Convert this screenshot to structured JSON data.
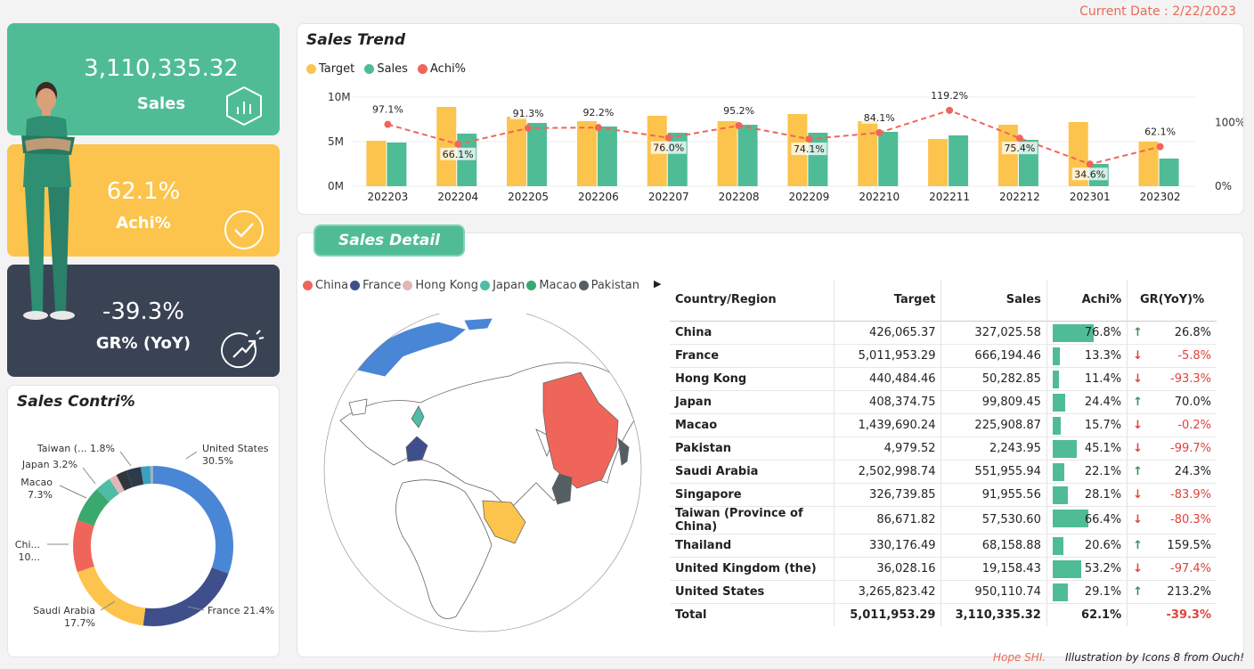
{
  "current_date": "Current Date : 2/22/2023",
  "kpi": {
    "sales_value": "3,110,335.32",
    "sales_label": "Sales",
    "achi_value": "62.1%",
    "achi_label": "Achi%",
    "gr_value": "-39.3%",
    "gr_label": "GR% (YoY)"
  },
  "colors": {
    "target": "#fcc44c",
    "sales": "#4fbc96",
    "achi": "#f0655a",
    "kpi_green": "#4fbc96",
    "kpi_yellow": "#fcc44c",
    "kpi_dark": "#3a4354",
    "down": "#e0413a",
    "up": "#3e8d58"
  },
  "trend": {
    "title": "Sales Trend",
    "legend": [
      "Target",
      "Sales",
      "Achi%"
    ],
    "y_ticks": [
      "10M",
      "5M",
      "0M"
    ],
    "y2_ticks": [
      "100%",
      "0%"
    ]
  },
  "chart_data": [
    {
      "type": "bar",
      "title": "Sales Trend",
      "categories": [
        "202203",
        "202204",
        "202205",
        "202206",
        "202207",
        "202208",
        "202209",
        "202210",
        "202211",
        "202212",
        "202301",
        "202302"
      ],
      "series": [
        {
          "name": "Target",
          "values": [
            5.1,
            8.9,
            7.8,
            7.3,
            7.9,
            7.3,
            8.1,
            7.3,
            5.3,
            6.9,
            7.2,
            5.0
          ]
        },
        {
          "name": "Sales",
          "values": [
            4.9,
            5.9,
            7.1,
            6.7,
            6.0,
            6.9,
            6.0,
            6.1,
            5.7,
            5.2,
            2.5,
            3.1
          ]
        },
        {
          "name": "Achi%",
          "values": [
            97.1,
            66.1,
            91.3,
            92.2,
            76.0,
            95.2,
            74.1,
            84.1,
            119.2,
            75.4,
            34.6,
            62.1
          ]
        }
      ],
      "labels": [
        "97.1%",
        "66.1%",
        "91.3%",
        "92.2%",
        "76.0%",
        "95.2%",
        "74.1%",
        "84.1%",
        "119.2%",
        "75.4%",
        "34.6%",
        "62.1%"
      ],
      "ylim": [
        0,
        10
      ],
      "y2lim": [
        0,
        140
      ]
    },
    {
      "type": "pie",
      "title": "Sales Contri%",
      "categories": [
        "United States",
        "France",
        "Saudi Arabia",
        "China",
        "Macao",
        "Japan",
        "Hong Kong",
        "Thailand",
        "Singapore",
        "Pakistan",
        "Taiwan (Province of China)",
        "United Kingdom (the)"
      ],
      "values": [
        30.5,
        21.4,
        17.7,
        10.5,
        7.3,
        3.2,
        1.6,
        2.2,
        2.9,
        0.1,
        1.8,
        0.6
      ]
    }
  ],
  "contri": {
    "title": "Sales Contri%",
    "labels": [
      {
        "l1": "United States",
        "l2": "30.5%"
      },
      {
        "l1": "France 21.4%",
        "l2": ""
      },
      {
        "l1": "Saudi Arabia",
        "l2": "17.7%"
      },
      {
        "l1": "Chi...",
        "l2": "10..."
      },
      {
        "l1": "Macao",
        "l2": "7.3%"
      },
      {
        "l1": "Japan 3.2%",
        "l2": ""
      },
      {
        "l1": "Taiwan (... 1.8%",
        "l2": ""
      }
    ]
  },
  "detail": {
    "title": "Sales Detail",
    "map_legend": [
      "China",
      "France",
      "Hong Kong",
      "Japan",
      "Macao",
      "Pakistan"
    ],
    "map_legend_colors": [
      "#f0655a",
      "#3f4f8c",
      "#e2b7b7",
      "#4fbca6",
      "#3aa96e",
      "#555e63"
    ],
    "headers": [
      "Country/Region",
      "Target",
      "Sales",
      "Achi%",
      "GR(YoY)%"
    ],
    "rows": [
      {
        "name": "China",
        "target": "426,065.37",
        "sales": "327,025.58",
        "achi": "76.8%",
        "achi_v": 76.8,
        "gr": "26.8%",
        "dir": "up"
      },
      {
        "name": "France",
        "target": "5,011,953.29",
        "sales": "666,194.46",
        "achi": "13.3%",
        "achi_v": 13.3,
        "gr": "-5.8%",
        "dir": "down"
      },
      {
        "name": "Hong Kong",
        "target": "440,484.46",
        "sales": "50,282.85",
        "achi": "11.4%",
        "achi_v": 11.4,
        "gr": "-93.3%",
        "dir": "down"
      },
      {
        "name": "Japan",
        "target": "408,374.75",
        "sales": "99,809.45",
        "achi": "24.4%",
        "achi_v": 24.4,
        "gr": "70.0%",
        "dir": "up"
      },
      {
        "name": "Macao",
        "target": "1,439,690.24",
        "sales": "225,908.87",
        "achi": "15.7%",
        "achi_v": 15.7,
        "gr": "-0.2%",
        "dir": "down"
      },
      {
        "name": "Pakistan",
        "target": "4,979.52",
        "sales": "2,243.95",
        "achi": "45.1%",
        "achi_v": 45.1,
        "gr": "-99.7%",
        "dir": "down"
      },
      {
        "name": "Saudi Arabia",
        "target": "2,502,998.74",
        "sales": "551,955.94",
        "achi": "22.1%",
        "achi_v": 22.1,
        "gr": "24.3%",
        "dir": "up"
      },
      {
        "name": "Singapore",
        "target": "326,739.85",
        "sales": "91,955.56",
        "achi": "28.1%",
        "achi_v": 28.1,
        "gr": "-83.9%",
        "dir": "down"
      },
      {
        "name": "Taiwan (Province of China)",
        "target": "86,671.82",
        "sales": "57,530.60",
        "achi": "66.4%",
        "achi_v": 66.4,
        "gr": "-80.3%",
        "dir": "down"
      },
      {
        "name": "Thailand",
        "target": "330,176.49",
        "sales": "68,158.88",
        "achi": "20.6%",
        "achi_v": 20.6,
        "gr": "159.5%",
        "dir": "up"
      },
      {
        "name": "United Kingdom (the)",
        "target": "36,028.16",
        "sales": "19,158.43",
        "achi": "53.2%",
        "achi_v": 53.2,
        "gr": "-97.4%",
        "dir": "down"
      },
      {
        "name": "United States",
        "target": "3,265,823.42",
        "sales": "950,110.74",
        "achi": "29.1%",
        "achi_v": 29.1,
        "gr": "213.2%",
        "dir": "up"
      }
    ],
    "total": {
      "name": "Total",
      "target": "5,011,953.29",
      "sales": "3,110,335.32",
      "achi": "62.1%",
      "gr": "-39.3%"
    }
  },
  "footer": {
    "author": "Hope SHI.",
    "credit": "Illustration by Icons 8 from Ouch!"
  }
}
